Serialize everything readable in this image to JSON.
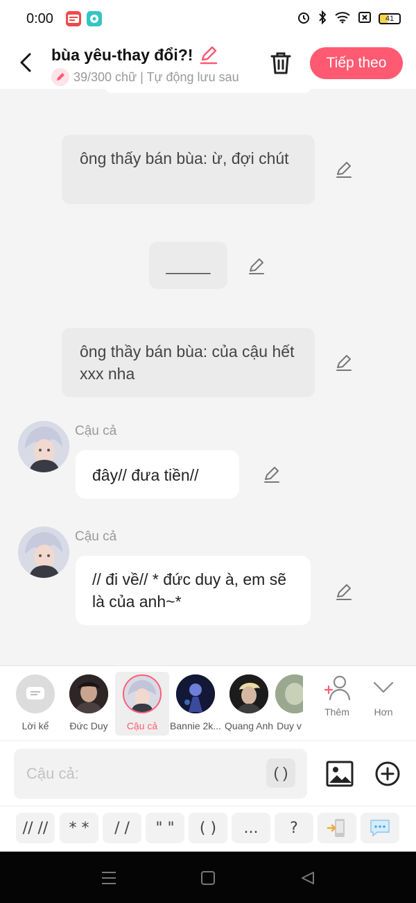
{
  "status_bar": {
    "time": "0:00",
    "apps": [
      {
        "name": "mangatoon-app-icon",
        "color": "#f0494a",
        "label": "MANGA TOON"
      },
      {
        "name": "chat-app-icon",
        "color": "#35c4c4",
        "label": ""
      }
    ],
    "battery": "41"
  },
  "header": {
    "title": "bùa yêu-thay đổi?!",
    "subtitle": "39/300 chữ | Tự động lưu sau",
    "next_label": "Tiếp theo",
    "accent": "#ff5a72"
  },
  "messages": {
    "narration_1": {
      "text": "ông thấy bán bùa: ừ, đợi chút"
    },
    "narration_2": {
      "text": "_____"
    },
    "narration_3": {
      "text": "ông thầy bán bùa: của cậu hết xxx nha"
    },
    "chat_1": {
      "speaker": "Cậu cả",
      "text": "đây// đưa tiền//"
    },
    "chat_2": {
      "speaker": "Cậu cả",
      "text": "// đi về// * đức duy à, em sẽ là của anh~*"
    }
  },
  "characters": [
    {
      "name": "Lời kể"
    },
    {
      "name": "Đức Duy"
    },
    {
      "name": "Cậu cả"
    },
    {
      "name": "Bannie 2k..."
    },
    {
      "name": "Quang Anh"
    },
    {
      "name": "Duy v"
    }
  ],
  "actions": {
    "add_label": "Thêm",
    "more_label": "Hơn"
  },
  "input": {
    "placeholder": "Cậu cả:",
    "paren": "( )"
  },
  "quick_inserts": [
    "// //",
    "* *",
    "/ /",
    "\" \"",
    "( )",
    "...",
    "?"
  ]
}
